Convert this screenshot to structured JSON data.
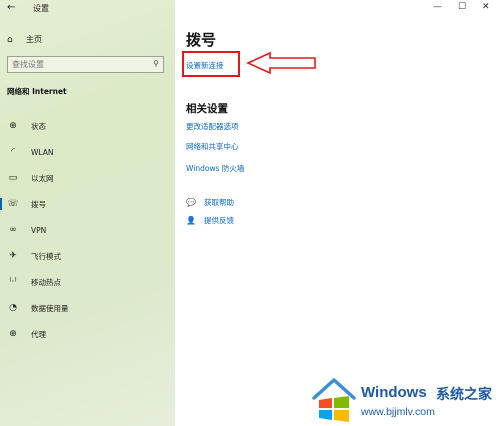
{
  "window": {
    "title": "设置",
    "back_icon": "←",
    "minimize_icon": "—",
    "maximize_icon": "☐",
    "close_icon": "✕"
  },
  "sidebar": {
    "home": {
      "icon": "⌂",
      "label": "主页"
    },
    "search": {
      "placeholder": "查找设置",
      "icon": "⚲"
    },
    "section_title": "网络和 Internet",
    "items": [
      {
        "icon": "⊕",
        "label": "状态"
      },
      {
        "icon": "◜",
        "label": "WLAN"
      },
      {
        "icon": "▭",
        "label": "以太网"
      },
      {
        "icon": "☏",
        "label": "拨号"
      },
      {
        "icon": "∞",
        "label": "VPN"
      },
      {
        "icon": "✈",
        "label": "飞行模式"
      },
      {
        "icon": "⁽·⁾",
        "label": "移动热点"
      },
      {
        "icon": "◔",
        "label": "数据使用量"
      },
      {
        "icon": "⊕",
        "label": "代理"
      }
    ],
    "active_index": 3
  },
  "main": {
    "title": "拨号",
    "setup_link": "设置新连接",
    "related_heading": "相关设置",
    "related_links": [
      "更改适配器选项",
      "网络和共享中心",
      "Windows 防火墙"
    ],
    "help": [
      {
        "icon": "💬",
        "label": "获取帮助"
      },
      {
        "icon": "👤",
        "label": "提供反馈"
      }
    ]
  },
  "watermark": {
    "brand": "Windows",
    "cn": "系统之家",
    "url": "www.bjjmlv.com"
  },
  "colors": {
    "link": "#0a66c2",
    "accent": "#0063b1",
    "annotation": "#e01a1a"
  }
}
